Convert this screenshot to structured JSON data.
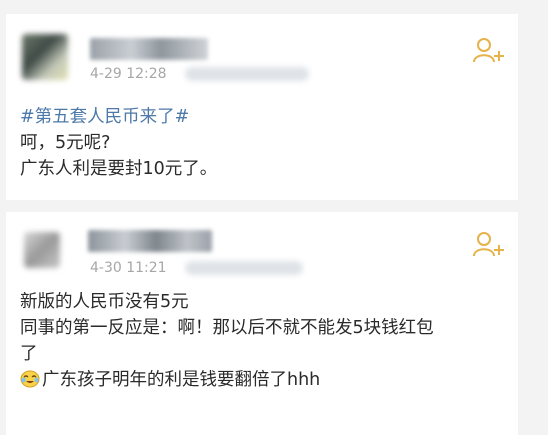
{
  "posts": [
    {
      "time": "4-29 12:28",
      "hashtag": "#第五套人民币来了#",
      "lines": [
        "呵，5元呢?",
        "广东人利是要封10元了。"
      ]
    },
    {
      "time": "4-30 11:21",
      "lines": [
        "新版的人民币没有5元",
        "同事的第一反应是：啊！那以后不就不能发5块钱红包",
        "了",
        "广东孩子明年的利是钱要翻倍了hhh"
      ],
      "emoji": "laughing-tears-emoji"
    }
  ],
  "icons": {
    "follow": "add-user-icon"
  },
  "colors": {
    "follow_icon": "#e6b24a",
    "hashtag": "#4d79a8",
    "meta": "#a7a7a7"
  }
}
